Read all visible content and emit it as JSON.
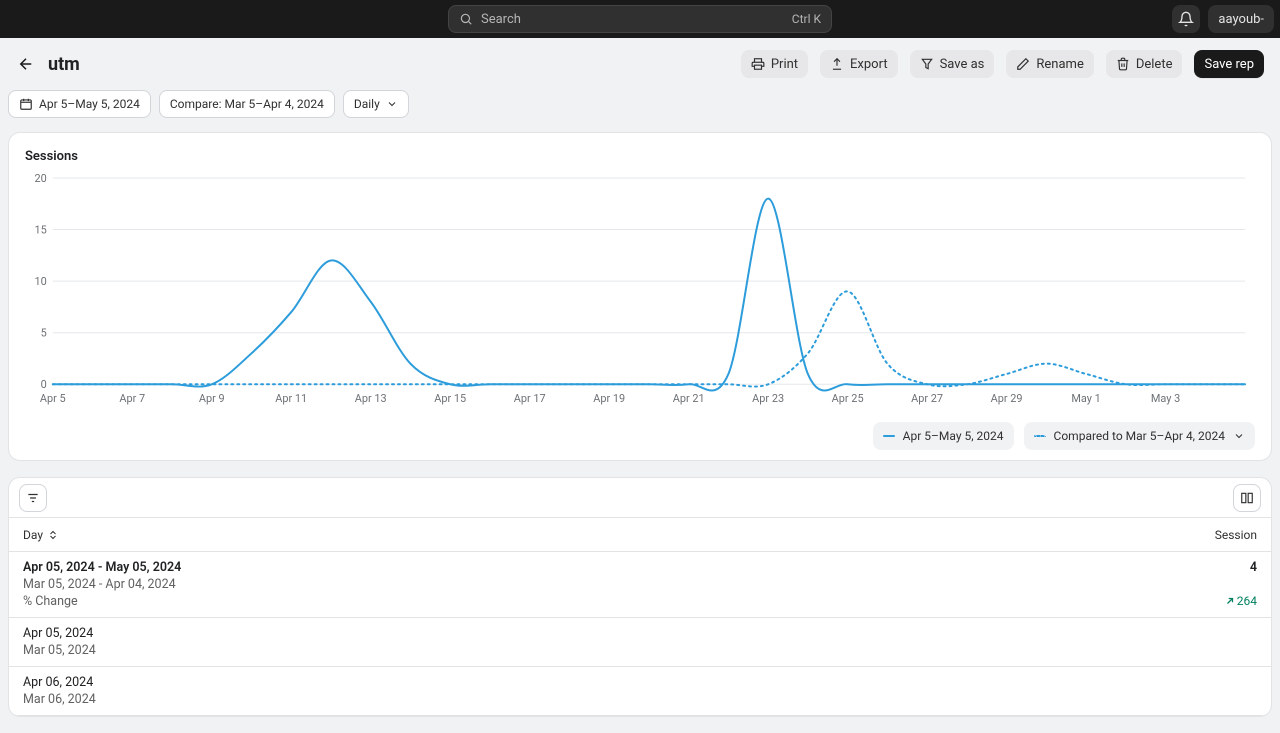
{
  "topbar": {
    "search_placeholder": "Search",
    "search_shortcut": "Ctrl K",
    "username": "aayoub-"
  },
  "header": {
    "page_title": "utm",
    "actions": {
      "print": "Print",
      "export": "Export",
      "saveas": "Save as",
      "rename": "Rename",
      "delete": "Delete",
      "save": "Save rep"
    }
  },
  "filters": {
    "date_range": "Apr 5–May 5, 2024",
    "compare": "Compare: Mar 5–Apr 4, 2024",
    "granularity": "Daily"
  },
  "legend": {
    "primary": "Apr 5–May 5, 2024",
    "compare": "Compared to Mar 5–Apr 4, 2024"
  },
  "table": {
    "col_day": "Day",
    "col_sessions": "Session",
    "summary": {
      "primary_range": "Apr 05, 2024 - May 05, 2024",
      "compare_range": "Mar 05, 2024 - Apr 04, 2024",
      "change_label": "% Change",
      "primary_total": "4",
      "delta": "264"
    },
    "rows": [
      {
        "primary": "Apr 05, 2024",
        "compare": "Mar 05, 2024"
      },
      {
        "primary": "Apr 06, 2024",
        "compare": "Mar 06, 2024"
      }
    ]
  },
  "chart_data": {
    "type": "line",
    "title": "Sessions",
    "xlabel": "",
    "ylabel": "",
    "ylim": [
      0,
      20
    ],
    "y_ticks": [
      0,
      5,
      10,
      15,
      20
    ],
    "categories": [
      "Apr 5",
      "Apr 6",
      "Apr 7",
      "Apr 8",
      "Apr 9",
      "Apr 10",
      "Apr 11",
      "Apr 12",
      "Apr 13",
      "Apr 14",
      "Apr 15",
      "Apr 16",
      "Apr 17",
      "Apr 18",
      "Apr 19",
      "Apr 20",
      "Apr 21",
      "Apr 22",
      "Apr 23",
      "Apr 24",
      "Apr 25",
      "Apr 26",
      "Apr 27",
      "Apr 28",
      "Apr 29",
      "Apr 30",
      "May 1",
      "May 2",
      "May 3",
      "May 4",
      "May 5"
    ],
    "x_tick_labels": [
      "Apr 5",
      "Apr 7",
      "Apr 9",
      "Apr 11",
      "Apr 13",
      "Apr 15",
      "Apr 17",
      "Apr 19",
      "Apr 21",
      "Apr 23",
      "Apr 25",
      "Apr 27",
      "Apr 29",
      "May 1",
      "May 3"
    ],
    "series": [
      {
        "name": "Apr 5–May 5, 2024",
        "style": "solid",
        "values": [
          0,
          0,
          0,
          0,
          0,
          3,
          7,
          12,
          8,
          2,
          0,
          0,
          0,
          0,
          0,
          0,
          0,
          1,
          18,
          1,
          0,
          0,
          0,
          0,
          0,
          0,
          0,
          0,
          0,
          0,
          0
        ]
      },
      {
        "name": "Compared to Mar 5–Apr 4, 2024",
        "style": "dotted",
        "values": [
          0,
          0,
          0,
          0,
          0,
          0,
          0,
          0,
          0,
          0,
          0,
          0,
          0,
          0,
          0,
          0,
          0,
          0,
          0,
          3,
          9,
          2,
          0,
          0,
          1,
          2,
          1,
          0,
          0,
          0,
          0
        ]
      }
    ],
    "colors": {
      "primary": "#2c9cdb",
      "compare": "#2c9cdb"
    }
  }
}
